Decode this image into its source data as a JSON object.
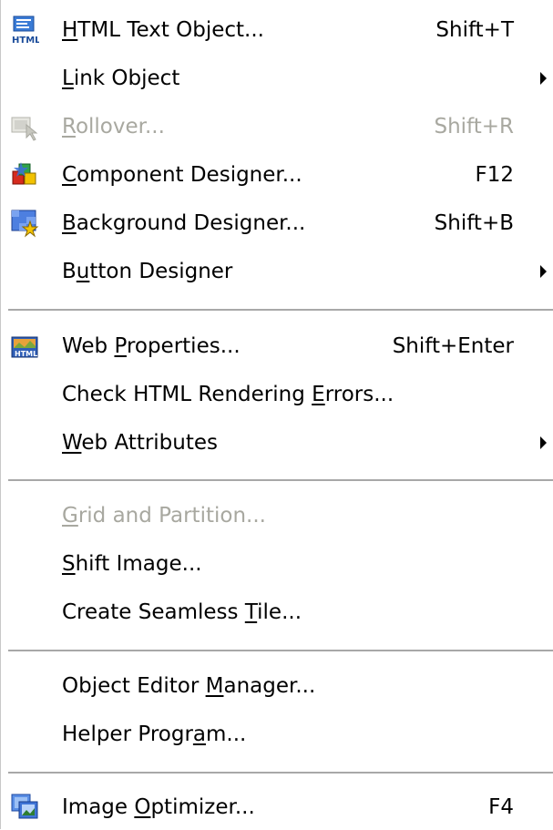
{
  "menu": {
    "items": [
      {
        "pre": "",
        "u": "H",
        "post": "TML Text Object...",
        "shortcut": "Shift+T",
        "icon": "html-text-object-icon"
      },
      {
        "pre": "",
        "u": "L",
        "post": "ink Object",
        "submenu": true
      },
      {
        "pre": "",
        "u": "R",
        "post": "ollover...",
        "shortcut": "Shift+R",
        "disabled": true,
        "icon": "rollover-icon"
      },
      {
        "pre": "",
        "u": "C",
        "post": "omponent Designer...",
        "shortcut": "F12",
        "icon": "component-designer-icon"
      },
      {
        "pre": "",
        "u": "B",
        "post": "ackground Designer...",
        "shortcut": "Shift+B",
        "icon": "background-designer-icon"
      },
      {
        "pre": "B",
        "u": "u",
        "post": "tton Designer",
        "submenu": true
      },
      {
        "pre": "Web ",
        "u": "P",
        "post": "roperties...",
        "shortcut": "Shift+Enter",
        "icon": "web-properties-icon"
      },
      {
        "pre": "Check HTML Rendering ",
        "u": "E",
        "post": "rrors..."
      },
      {
        "pre": "",
        "u": "W",
        "post": "eb Attributes",
        "submenu": true
      },
      {
        "pre": "",
        "u": "G",
        "post": "rid and Partition...",
        "disabled": true
      },
      {
        "pre": "",
        "u": "S",
        "post": "hift Image..."
      },
      {
        "pre": "Create Seamless ",
        "u": "T",
        "post": "ile..."
      },
      {
        "pre": "Object Editor ",
        "u": "M",
        "post": "anager..."
      },
      {
        "pre": "Helper Progr",
        "u": "a",
        "post": "m..."
      },
      {
        "pre": "Image ",
        "u": "O",
        "post": "ptimizer...",
        "shortcut": "F4",
        "icon": "image-optimizer-icon"
      }
    ]
  }
}
